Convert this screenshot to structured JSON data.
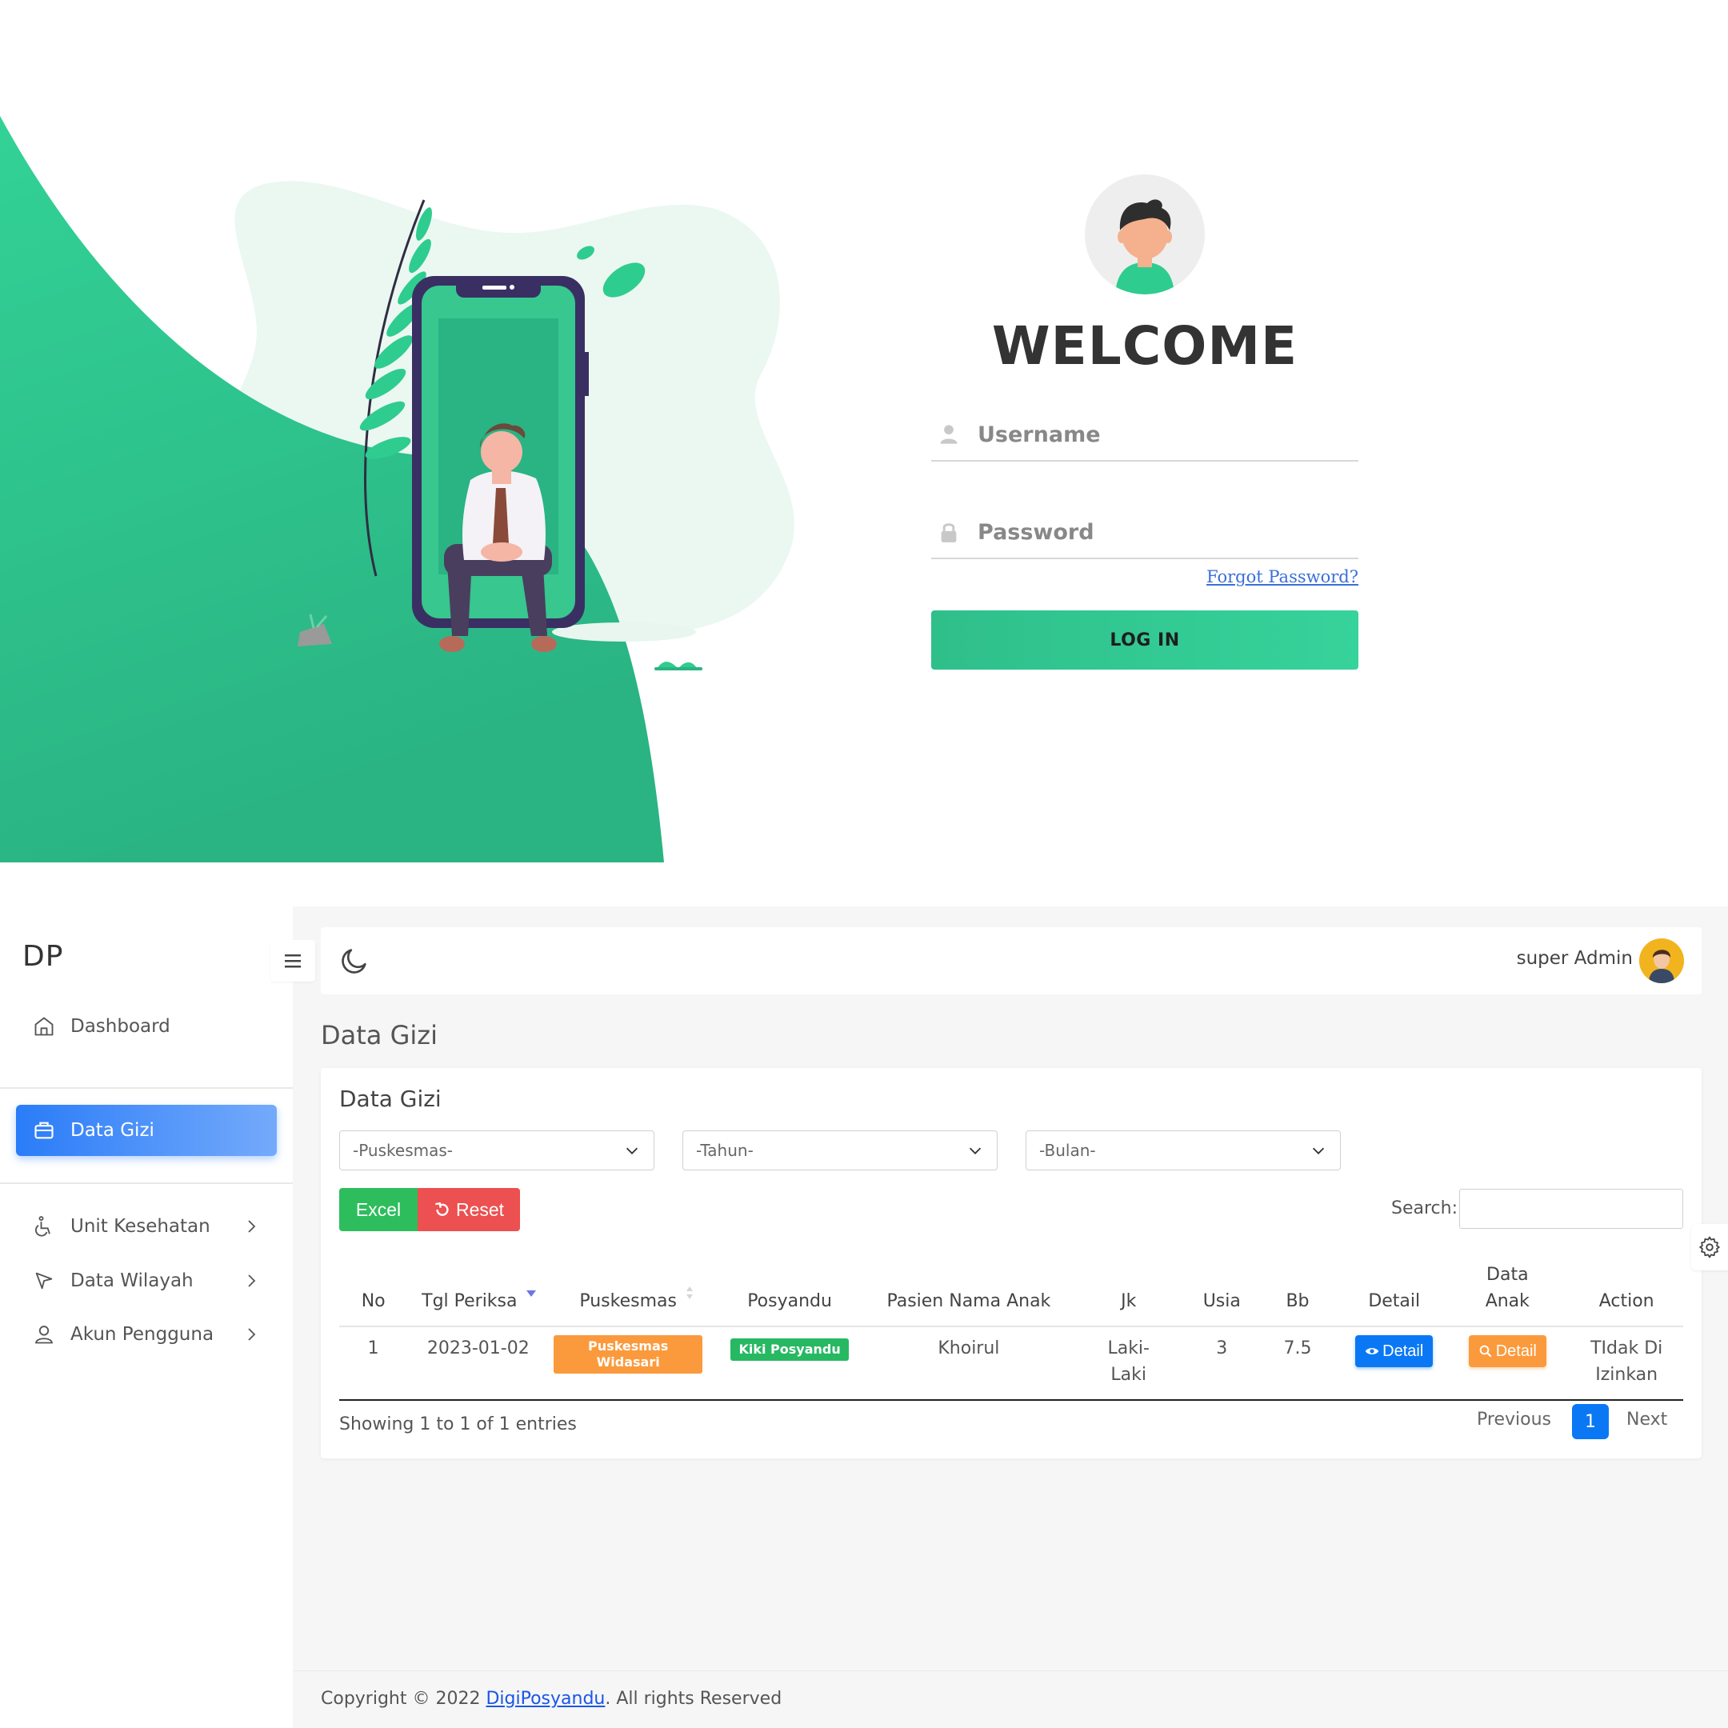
{
  "login": {
    "welcome": "WELCOME",
    "username_placeholder": "Username",
    "password_placeholder": "Password",
    "forgot_password": "Forgot Password?",
    "login_button": "LOG IN",
    "icons": {
      "username": "user-icon",
      "password": "lock-icon",
      "avatar": "user-avatar-illustration"
    },
    "colors": {
      "accent": "#2fcc8f",
      "accent_dark": "#2ab383"
    }
  },
  "sidebar": {
    "brand": "DP",
    "items": [
      {
        "label": "Dashboard",
        "icon": "home-icon",
        "active": false,
        "has_submenu": false
      },
      {
        "label": "Data Gizi",
        "icon": "briefcase-icon",
        "active": true,
        "has_submenu": false
      },
      {
        "label": "Unit Kesehatan",
        "icon": "wheelchair-icon",
        "active": false,
        "has_submenu": true
      },
      {
        "label": "Data Wilayah",
        "icon": "navigation-icon",
        "active": false,
        "has_submenu": true
      },
      {
        "label": "Akun Pengguna",
        "icon": "user-icon",
        "active": false,
        "has_submenu": true
      }
    ]
  },
  "topbar": {
    "user_name": "super Admin",
    "theme_icon": "moon-icon",
    "menu_icon": "hamburger-icon"
  },
  "page": {
    "title": "Data Gizi"
  },
  "card": {
    "title": "Data Gizi",
    "filters": [
      {
        "selected": "-Puskesmas-"
      },
      {
        "selected": "-Tahun-"
      },
      {
        "selected": "-Bulan-"
      }
    ],
    "excel_button": "Excel",
    "reset_button": "Reset",
    "search_label": "Search:",
    "search_value": "",
    "table": {
      "headers": [
        "No",
        "Tgl Periksa",
        "Puskesmas",
        "Posyandu",
        "Pasien Nama Anak",
        "Jk",
        "Usia",
        "Bb",
        "Detail",
        "Data Anak",
        "Action"
      ],
      "rows": [
        {
          "no": "1",
          "tgl_periksa": "2023-01-02",
          "puskesmas": "Puskesmas Widasari",
          "posyandu": "Kiki Posyandu",
          "nama_anak": "Khoirul",
          "jk": "Laki-Laki",
          "usia": "3",
          "bb": "7.5",
          "detail_button": "Detail",
          "data_anak_button": "Detail",
          "action": "TIdak Di Izinkan"
        }
      ]
    },
    "info": "Showing 1 to 1 of 1 entries",
    "pagination": {
      "previous": "Previous",
      "current": "1",
      "next": "Next"
    }
  },
  "footer": {
    "prefix": "Copyright © 2022 ",
    "link": "DigiPosyandu",
    "suffix": ". All rights Reserved"
  },
  "colors": {
    "primary": "#0a78f5",
    "success": "#2ebd5d",
    "danger": "#ec5050",
    "warning": "#fb9a3c"
  }
}
